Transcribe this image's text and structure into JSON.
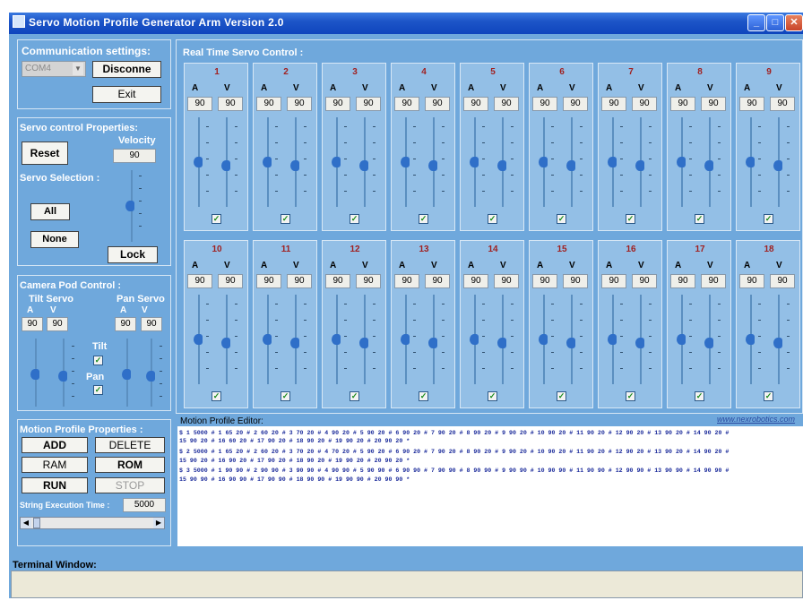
{
  "window": {
    "title": "Servo Motion Profile Generator Arm Version 2.0"
  },
  "comm": {
    "title": "Communication settings:",
    "port": "COM4",
    "disconnect_label": "Disconne",
    "exit_label": "Exit"
  },
  "servo_props": {
    "title": "Servo control Properties:",
    "reset_label": "Reset",
    "velocity_label": "Velocity",
    "velocity_value": "90",
    "selection_label": "Servo Selection :",
    "all_label": "All",
    "none_label": "None",
    "lock_label": "Lock"
  },
  "camera": {
    "title": "Camera Pod  Control :",
    "tilt_label": "Tilt Servo",
    "pan_label": "Pan Servo",
    "a": "A",
    "v": "V",
    "tilt_a": "90",
    "tilt_v": "90",
    "pan_a": "90",
    "pan_v": "90",
    "tilt_check": "Tilt",
    "pan_check": "Pan"
  },
  "motion": {
    "title": "Motion Profile Properties :",
    "add": "ADD",
    "delete": "DELETE",
    "ram": "RAM",
    "rom": "ROM",
    "run": "RUN",
    "stop": "STOP",
    "exec_label": "String Execution Time :",
    "exec_value": "5000"
  },
  "realtime": {
    "title": "Real Time Servo Control :"
  },
  "servos": [
    {
      "num": "1",
      "a": "90",
      "v": "90"
    },
    {
      "num": "2",
      "a": "90",
      "v": "90"
    },
    {
      "num": "3",
      "a": "90",
      "v": "90"
    },
    {
      "num": "4",
      "a": "90",
      "v": "90"
    },
    {
      "num": "5",
      "a": "90",
      "v": "90"
    },
    {
      "num": "6",
      "a": "90",
      "v": "90"
    },
    {
      "num": "7",
      "a": "90",
      "v": "90"
    },
    {
      "num": "8",
      "a": "90",
      "v": "90"
    },
    {
      "num": "9",
      "a": "90",
      "v": "90"
    },
    {
      "num": "10",
      "a": "90",
      "v": "90"
    },
    {
      "num": "11",
      "a": "90",
      "v": "90"
    },
    {
      "num": "12",
      "a": "90",
      "v": "90"
    },
    {
      "num": "13",
      "a": "90",
      "v": "90"
    },
    {
      "num": "14",
      "a": "90",
      "v": "90"
    },
    {
      "num": "15",
      "a": "90",
      "v": "90"
    },
    {
      "num": "16",
      "a": "90",
      "v": "90"
    },
    {
      "num": "17",
      "a": "90",
      "v": "90"
    },
    {
      "num": "18",
      "a": "90",
      "v": "90"
    }
  ],
  "editor": {
    "title": "Motion Profile Editor:",
    "link": "www.nexrobotics.com",
    "lines": [
      "$ 1 5000 # 1 65 20 # 2 60 20 # 3 70 20 # 4 90 20 # 5 90 20 # 6 90 20 # 7 90 20 # 8 90 20 # 9 90 20 # 10 90 20 # 11 90 20 # 12 90 20 # 13 90 20 # 14 90 20 #",
      "15 90 20 # 16 60 20 # 17 90 20 # 18 90 20 # 19 90 20 # 20 90 20 *",
      "$ 2 5000 # 1 65 20 # 2 60 20 # 3 70 20 # 4 70 20 # 5 90 20 # 6 90 20 # 7 90 20 # 8 90 20 # 9 90 20 # 10 90 20 # 11 90 20 # 12 90 20 # 13 90 20 # 14 90 20 #",
      "15 90 20 # 16 90 20 # 17 90 20 # 18 90 20 # 19 90 20 # 20 90 20 *",
      "$ 3 5000 # 1 90 90 # 2 90 90 # 3 90 90 # 4 90 90 # 5 90 90 # 6 90 90 # 7 90 90 # 8 90 90 # 9 90 90 # 10 90 90 # 11 90 90 # 12 90 90 # 13 90 90 # 14 90 90 #",
      "15 90 90 # 16 90 90 # 17 90 90 # 18 90 90 # 19 90 90 # 20 90 90 *"
    ]
  },
  "terminal": {
    "title": "Terminal Window:"
  },
  "checkmark": "✓",
  "colors": {
    "window_bg": "#6FA8DC",
    "panel_bg": "#93BFE6",
    "title_bar": "#1d55c8",
    "editor_text": "#1a2a9a"
  }
}
